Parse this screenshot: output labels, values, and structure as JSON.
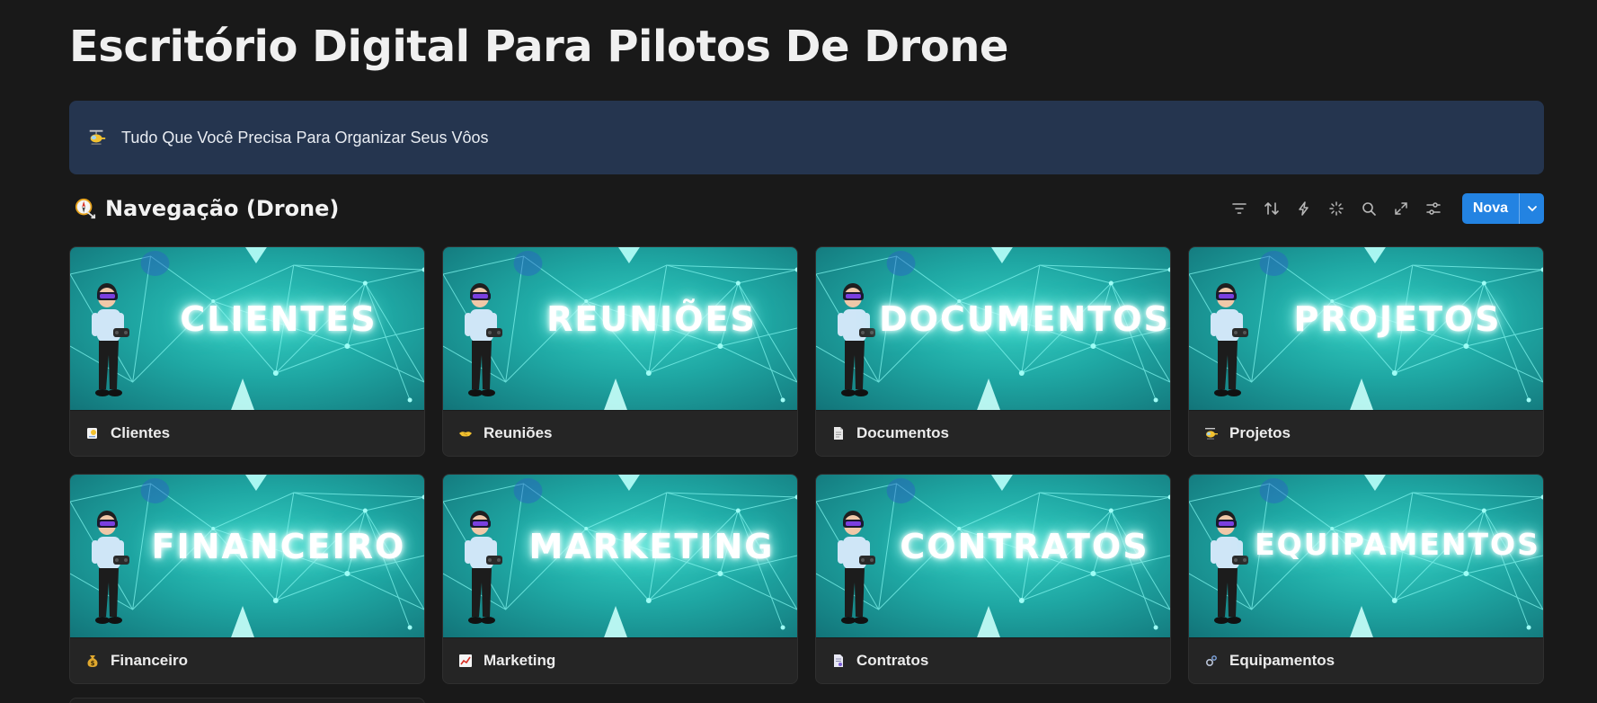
{
  "page": {
    "title": "Escritório Digital Para Pilotos De Drone"
  },
  "callout": {
    "icon": "helicopter-icon",
    "text": "Tudo Que Você Precisa Para Organizar Seus Vôos"
  },
  "database": {
    "icon": "compass-icon",
    "title": "Navegação (Drone)",
    "toolbar": [
      "filter-icon",
      "sort-icon",
      "automation-icon",
      "ai-sparkle-icon",
      "search-icon",
      "expand-icon",
      "settings-icon"
    ],
    "new_button_label": "Nova"
  },
  "cards": [
    {
      "cover_text": "CLIENTES",
      "icon": "client-card-icon",
      "label": "Clientes"
    },
    {
      "cover_text": "REUNIÕES",
      "icon": "handshake-icon",
      "label": "Reuniões"
    },
    {
      "cover_text": "DOCUMENTOS",
      "icon": "document-icon",
      "label": "Documentos"
    },
    {
      "cover_text": "PROJETOS",
      "icon": "helicopter-icon",
      "label": "Projetos"
    },
    {
      "cover_text": "FINANCEIRO",
      "icon": "money-bag-icon",
      "label": "Financeiro"
    },
    {
      "cover_text": "MARKETING",
      "icon": "chart-icon",
      "label": "Marketing"
    },
    {
      "cover_text": "CONTRATOS",
      "icon": "contract-icon",
      "label": "Contratos"
    },
    {
      "cover_text": "EQUIPAMENTOS",
      "icon": "gear-tools-icon",
      "label": "Equipamentos"
    }
  ],
  "colors": {
    "background": "#191919",
    "callout": "#25354f",
    "accent": "#2383e2",
    "cover_teal": "#1fa8a4"
  }
}
